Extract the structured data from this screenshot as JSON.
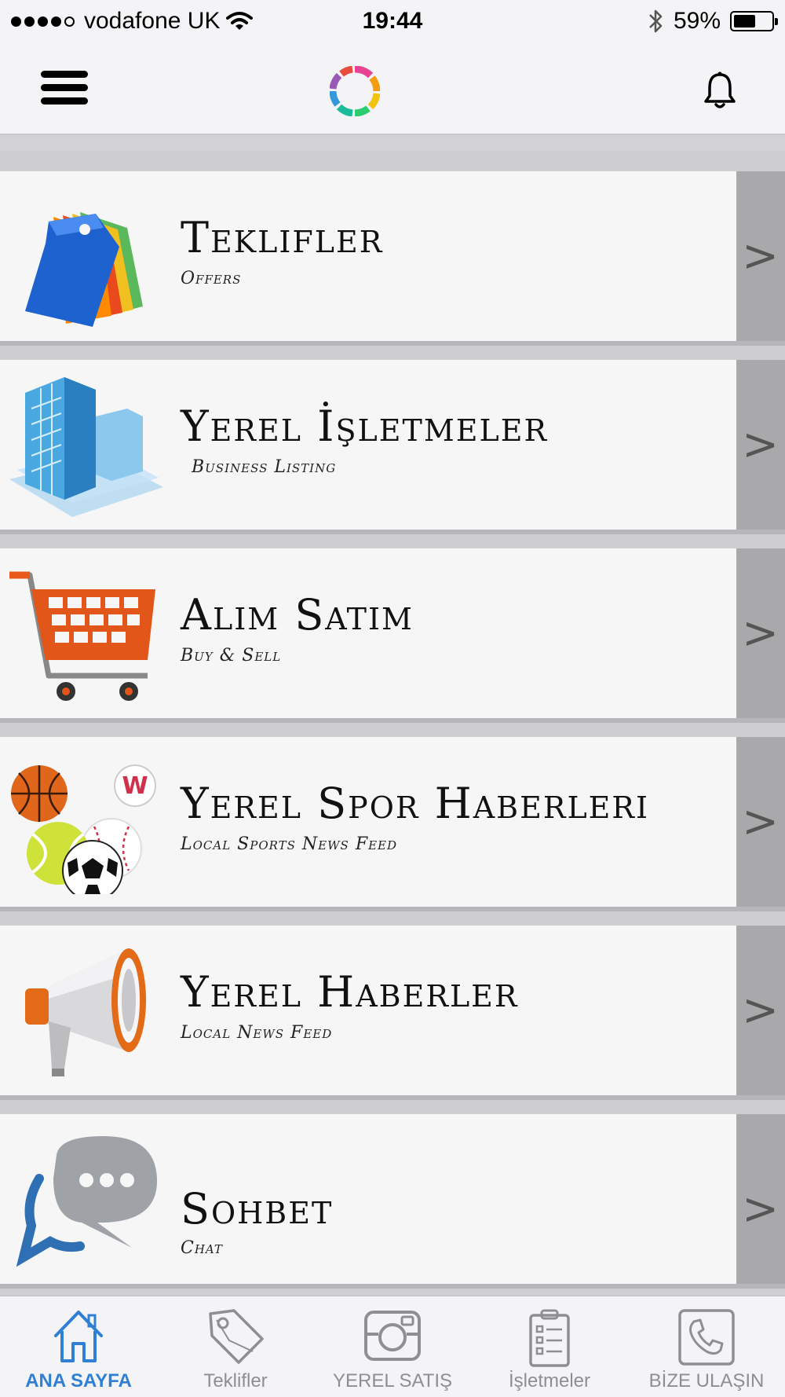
{
  "status_bar": {
    "carrier": "vodafone UK",
    "time": "19:44",
    "battery_percent": "59%",
    "battery_level": 0.59
  },
  "nav": {
    "menu_icon": "hamburger-menu-icon",
    "logo_icon": "app-logo-icon",
    "bell_icon": "bell-icon"
  },
  "menu_items": [
    {
      "title": "Teklifler",
      "subtitle": "Offers",
      "icon": "price-tags-icon"
    },
    {
      "title": "Yerel İşletmeler",
      "subtitle": "Business Listing",
      "icon": "office-building-icon"
    },
    {
      "title": "Alım Satım",
      "subtitle": "Buy & Sell",
      "icon": "shopping-cart-icon"
    },
    {
      "title": "Yerel Spor Haberleri",
      "subtitle": "Local Sports News Feed",
      "icon": "sports-balls-icon"
    },
    {
      "title": "Yerel Haberler",
      "subtitle": "Local News Feed",
      "icon": "megaphone-icon"
    },
    {
      "title": "Sohbet",
      "subtitle": "Chat",
      "icon": "chat-bubbles-icon"
    }
  ],
  "chevron": ">",
  "tabs": [
    {
      "label": "ANA SAYFA",
      "icon": "home-icon",
      "active": true
    },
    {
      "label": "Teklifler",
      "icon": "tag-icon",
      "active": false
    },
    {
      "label": "YEREL SATIŞ",
      "icon": "camera-icon",
      "active": false
    },
    {
      "label": "İşletmeler",
      "icon": "clipboard-list-icon",
      "active": false
    },
    {
      "label": "BİZE ULAŞIN",
      "icon": "phone-icon",
      "active": false
    }
  ],
  "colors": {
    "accent": "#2f7fd4",
    "tab_inactive": "#8e8e93",
    "chevron_strip": "#a9a9ab"
  }
}
